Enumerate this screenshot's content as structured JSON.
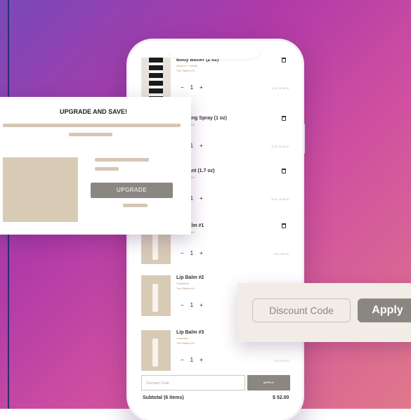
{
  "cart": {
    "items": [
      {
        "name": "Body Butter (2 oz)",
        "variant": "Almond + Vanilla",
        "kit": "The Starter Kit",
        "qty": "1",
        "price": "$ 12 / $ 16.00"
      },
      {
        "name": "Soothing Spray (1 oz)",
        "variant": "",
        "kit": "The Starter Kit",
        "qty": "1",
        "price": "$ 12 / $ 16.00"
      },
      {
        "name": "Fragrant (1.7 oz)",
        "variant": "",
        "kit": "The Starter Kit",
        "qty": "1",
        "price": "$ 12 / $ 16.00"
      },
      {
        "name": "Lip Balm #1",
        "variant": "",
        "kit": "The Starter Kit",
        "qty": "1",
        "price": "$ 3 / $ 4.00"
      },
      {
        "name": "Lip Balm #2",
        "variant": "Grapefruit",
        "kit": "The Starter Kit",
        "qty": "1",
        "price": ""
      },
      {
        "name": "Lip Balm #3",
        "variant": "Lavender",
        "kit": "The Starter Kit",
        "qty": "1",
        "price": "$ 3 / $ 4.00"
      }
    ],
    "discount_placeholder": "Discount Code",
    "apply_label": "APPLY",
    "subtotal_label": "Subtotal (6 items)",
    "subtotal_value": "$ 52.00"
  },
  "upgrade_card": {
    "title": "UPGRADE AND SAVE!",
    "button_label": "UPGRADE"
  },
  "discount_card": {
    "placeholder": "Discount Code",
    "button_label": "Apply"
  },
  "colors": {
    "accent_gray": "#8a8783",
    "beige": "#d6c6b3",
    "bg_start": "#7a48b8",
    "bg_end": "#e0788a"
  }
}
